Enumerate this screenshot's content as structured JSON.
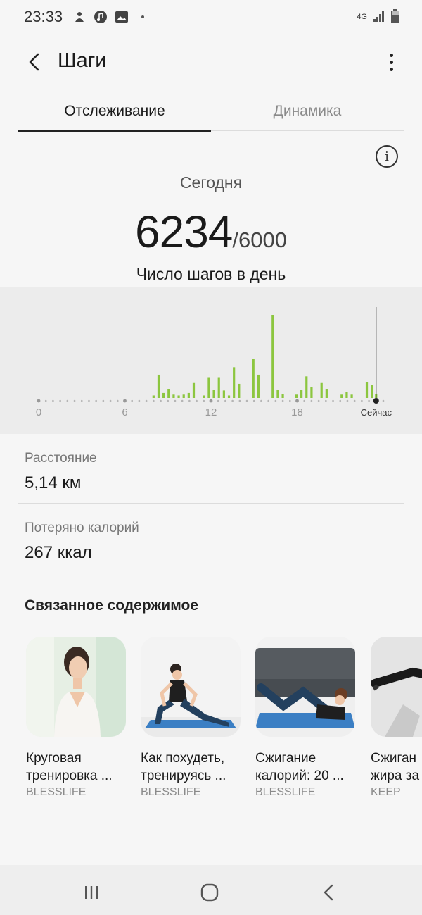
{
  "status": {
    "time": "23:33",
    "network": "4G",
    "icons": [
      "notification-icon",
      "music-icon",
      "gallery-icon",
      "dot-icon",
      "signal-icon",
      "battery-icon"
    ]
  },
  "appbar": {
    "title": "Шаги"
  },
  "tabs": [
    {
      "label": "Отслеживание",
      "active": true
    },
    {
      "label": "Динамика",
      "active": false
    }
  ],
  "summary": {
    "day": "Сегодня",
    "steps": "6234",
    "goal": "/6000",
    "caption": "Число шагов в день"
  },
  "chart_data": {
    "type": "bar",
    "x_ticks": [
      "0",
      "6",
      "12",
      "18",
      "Сейчас"
    ],
    "xlim": [
      0,
      24
    ],
    "current_hour": 23.5,
    "bar_color": "#8cc63f",
    "bars": [
      {
        "hour": 8.0,
        "v": 0.03
      },
      {
        "hour": 8.35,
        "v": 0.28
      },
      {
        "hour": 8.7,
        "v": 0.06
      },
      {
        "hour": 9.05,
        "v": 0.11
      },
      {
        "hour": 9.4,
        "v": 0.04
      },
      {
        "hour": 9.75,
        "v": 0.03
      },
      {
        "hour": 10.1,
        "v": 0.04
      },
      {
        "hour": 10.45,
        "v": 0.06
      },
      {
        "hour": 10.8,
        "v": 0.18
      },
      {
        "hour": 11.5,
        "v": 0.03
      },
      {
        "hour": 11.85,
        "v": 0.25
      },
      {
        "hour": 12.2,
        "v": 0.1
      },
      {
        "hour": 12.55,
        "v": 0.25
      },
      {
        "hour": 12.9,
        "v": 0.09
      },
      {
        "hour": 13.25,
        "v": 0.03
      },
      {
        "hour": 13.6,
        "v": 0.37
      },
      {
        "hour": 13.95,
        "v": 0.17
      },
      {
        "hour": 14.95,
        "v": 0.47
      },
      {
        "hour": 15.3,
        "v": 0.28
      },
      {
        "hour": 16.3,
        "v": 1.0
      },
      {
        "hour": 16.65,
        "v": 0.1
      },
      {
        "hour": 17.0,
        "v": 0.05
      },
      {
        "hour": 17.95,
        "v": 0.04
      },
      {
        "hour": 18.3,
        "v": 0.1
      },
      {
        "hour": 18.65,
        "v": 0.26
      },
      {
        "hour": 19.0,
        "v": 0.13
      },
      {
        "hour": 19.7,
        "v": 0.18
      },
      {
        "hour": 20.05,
        "v": 0.11
      },
      {
        "hour": 21.1,
        "v": 0.04
      },
      {
        "hour": 21.45,
        "v": 0.07
      },
      {
        "hour": 21.8,
        "v": 0.04
      },
      {
        "hour": 22.85,
        "v": 0.19
      },
      {
        "hour": 23.2,
        "v": 0.16
      },
      {
        "hour": 23.5,
        "v": 0.05
      }
    ]
  },
  "stats": {
    "distance_label": "Расстояние",
    "distance_value": "5,14 км",
    "calories_label": "Потеряно калорий",
    "calories_value": "267 ккал"
  },
  "related": {
    "title": "Связанное содержимое",
    "cards": [
      {
        "line1": "Круговая",
        "line2": "тренировка ...",
        "source": "BLESSLIFE"
      },
      {
        "line1": "Как похудеть,",
        "line2": "тренируясь ...",
        "source": "BLESSLIFE"
      },
      {
        "line1": "Сжигание",
        "line2": "калорий: 20 ...",
        "source": "BLESSLIFE"
      },
      {
        "line1": "Сжиган",
        "line2": "жира за",
        "source": "KEEP"
      }
    ]
  }
}
